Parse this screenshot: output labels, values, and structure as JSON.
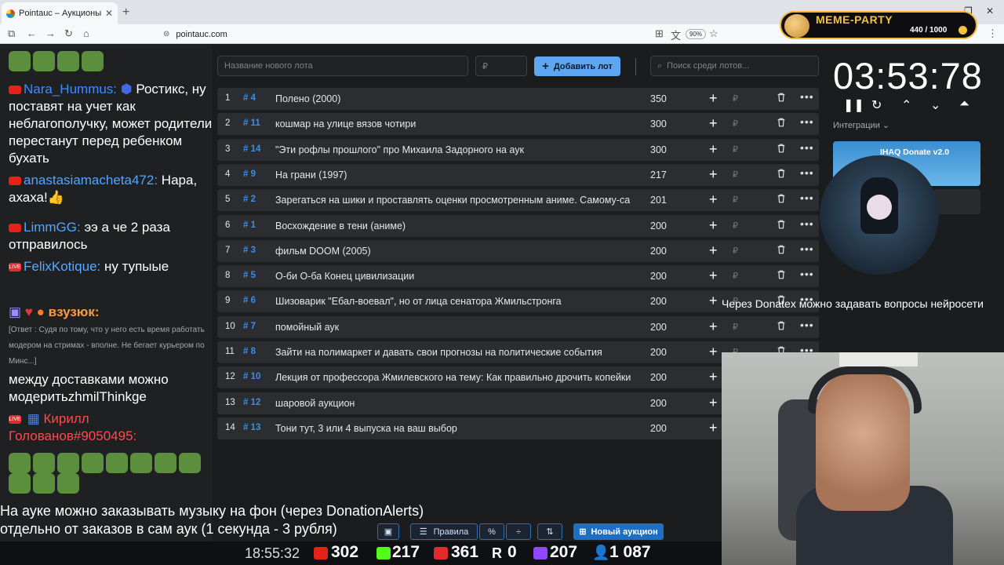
{
  "browser": {
    "tab_title": "Pointauc – Аукционы, лотереи",
    "url": "pointauc.com",
    "zoom": "90%"
  },
  "meme_party": {
    "title": "MEME-PARTY",
    "count": "440 / 1000"
  },
  "chat": {
    "lines": [
      {
        "user": "Nara_Hummus:",
        "text": "Ростикс, ну поставят на учет как неблагополучку, может родители перестанут перед ребенком бухать"
      },
      {
        "user": "anastasiamacheta472:",
        "text": "Нара, ахаха!👍"
      },
      {
        "user": "LimmGG:",
        "text": "ээ а че 2 раза отправилось"
      },
      {
        "user": "FelixKotique:",
        "text": "ну тупыые"
      },
      {
        "user": "взузюк:",
        "text": ""
      },
      {
        "reply": "[Ответ : Судя по тому, что у него есть время работать модером на стримах - вполне. Не бегает курьером по Минс...]"
      },
      {
        "text": "между доставками можно модеритьzhmilThinkge"
      },
      {
        "user": "Кирилл Голованов#9050495:",
        "text": ""
      }
    ]
  },
  "toolbar": {
    "new_lot_placeholder": "Название нового лота",
    "amount_placeholder": "₽",
    "add_lot": "Добавить лот",
    "search_placeholder": "Поиск среди лотов..."
  },
  "lots": [
    {
      "num": "1",
      "id": "# 4",
      "name": "Полено (2000)",
      "amount": "350"
    },
    {
      "num": "2",
      "id": "# 11",
      "name": "кошмар на улице вязов чотири",
      "amount": "300"
    },
    {
      "num": "3",
      "id": "# 14",
      "name": "\"Эти рофлы прошлого\" про Михаила Задорного на аук",
      "amount": "300"
    },
    {
      "num": "4",
      "id": "# 9",
      "name": "На грани (1997)",
      "amount": "217"
    },
    {
      "num": "5",
      "id": "# 2",
      "name": "Зарегаться на шики и проставлять оценки просмотренным аниме. Самому-са",
      "amount": "201"
    },
    {
      "num": "6",
      "id": "# 1",
      "name": "Восхождение в тени (аниме)",
      "amount": "200"
    },
    {
      "num": "7",
      "id": "# 3",
      "name": "фильм DOOM (2005)",
      "amount": "200"
    },
    {
      "num": "8",
      "id": "# 5",
      "name": "О-би О-ба Конец цивилизации",
      "amount": "200"
    },
    {
      "num": "9",
      "id": "# 6",
      "name": "Шизоварик \"Ебал-воевал\", но от лица сенатора Жмильстронга",
      "amount": "200"
    },
    {
      "num": "10",
      "id": "# 7",
      "name": "помойный аук",
      "amount": "200"
    },
    {
      "num": "11",
      "id": "# 8",
      "name": "Зайти на полимаркет и давать свои прогнозы на политические события",
      "amount": "200"
    },
    {
      "num": "12",
      "id": "# 10",
      "name": "Лекция от профессора Жмилевского на тему: Как правильно дрочить копейки",
      "amount": "200"
    },
    {
      "num": "13",
      "id": "# 12",
      "name": "шаровой аукцион",
      "amount": "200"
    },
    {
      "num": "14",
      "id": "# 13",
      "name": "Тони тут, 3 или 4 выпуска на ваш выбор",
      "amount": "200"
    }
  ],
  "timer": {
    "value": "03:53:78"
  },
  "integrations": {
    "label": "Интеграции"
  },
  "donate": {
    "title": "IHAQ Donate v2.0"
  },
  "captions": {
    "donatex": "Через Donatex можно задавать вопросы нейросети",
    "music_line1": "На ауке можно заказывать музыку на фон (через DonationAlerts)",
    "music_line2": "отдельно от заказов в сам аук (1 секунда - 3 рубля)"
  },
  "bottom_toolbar": {
    "rules": "Правила",
    "new_auction": "Новый аукцион"
  },
  "status": {
    "clock": "18:55:32",
    "youtube": "302",
    "kick": "217",
    "vk": "361",
    "rumble": "0",
    "twitch": "207",
    "viewers": "1 087"
  }
}
